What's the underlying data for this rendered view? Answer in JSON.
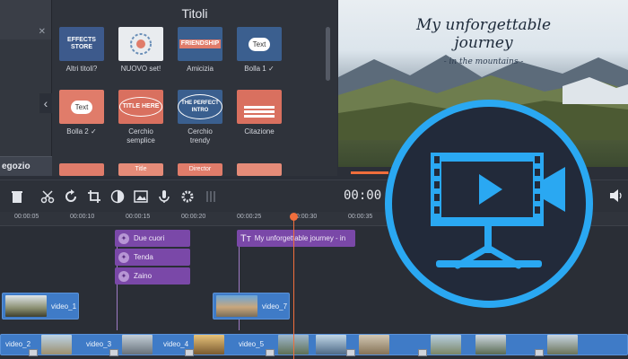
{
  "titles_panel": {
    "heading": "Titoli",
    "tiles": [
      {
        "caption": "Altri titoli?",
        "thumb_text": "EFFECTS STORE",
        "color": "#3d5a8c"
      },
      {
        "caption": "NUOVO set!",
        "thumb_text": "",
        "color": "#e9ecef"
      },
      {
        "caption": "Amicizia",
        "thumb_text": "FRIENDSHIP",
        "color": "#3a5f8f"
      },
      {
        "caption": "Bolla 1 ✓",
        "thumb_text": "Text",
        "color": "#3b5f8f"
      },
      {
        "caption": "Bolla 2 ✓",
        "thumb_text": "Text",
        "color": "#e07c6a"
      },
      {
        "caption": "Cerchio semplice",
        "thumb_text": "TITLE HERE",
        "color": "#d9705f"
      },
      {
        "caption": "Cerchio trendy",
        "thumb_text": "THE PERFECT INTRO",
        "color": "#3a5f8f"
      },
      {
        "caption": "Citazione",
        "thumb_text": "",
        "color": "#d9705f"
      },
      {
        "caption": "",
        "thumb_text": "",
        "color": "#e07c6a"
      },
      {
        "caption": "",
        "thumb_text": "Title",
        "color": "#e58b78"
      },
      {
        "caption": "",
        "thumb_text": "Director",
        "color": "#e07c6a"
      },
      {
        "caption": "",
        "thumb_text": "",
        "color": "#e58b78"
      }
    ]
  },
  "left_panel": {
    "item_active": "egozio"
  },
  "preview": {
    "title": "My unforgettable journey",
    "subtitle": "- in the mountains -",
    "progress_fraction": 0.14
  },
  "toolbar": {
    "time": "00:00",
    "icons": [
      "trash-icon",
      "scissors-icon",
      "rotate-icon",
      "crop-icon",
      "color-icon",
      "image-icon",
      "mic-icon",
      "gear-icon",
      "equalizer-icon"
    ]
  },
  "ruler": {
    "ticks": [
      "00:00:05",
      "00:00:10",
      "00:00:15",
      "00:00:20",
      "00:00:25",
      "00:00:30",
      "00:00:35"
    ]
  },
  "timeline": {
    "title_clips": [
      "Due cuori",
      "Tenda",
      "Zaino"
    ],
    "long_title_clip": "My unforgettable journey - in",
    "video_overlay_1": "video_1",
    "video_overlay_7": "video_7",
    "main_labels": [
      "video_2",
      "video_3",
      "video_4",
      "video_5"
    ]
  },
  "colors": {
    "accent": "#f06e3c",
    "title_clip": "#7a48a8",
    "video_clip": "#3f7bc7",
    "logo_blue": "#2aa8f2",
    "logo_dark": "#222a3a"
  }
}
